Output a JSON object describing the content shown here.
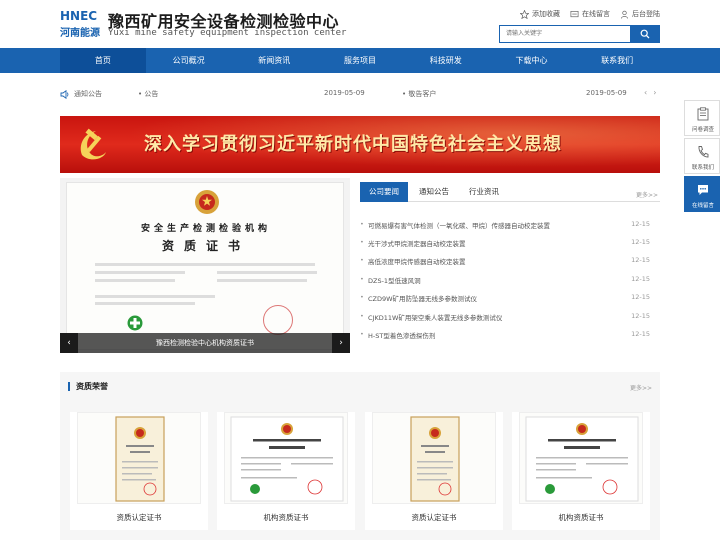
{
  "header": {
    "logo_line1": "HNEC",
    "logo_line2": "河南能源",
    "title": "豫西矿用安全设备检测检验中心",
    "subtitle": "Yuxi mine safety equipment inspection center",
    "links": [
      "添加收藏",
      "在线留言",
      "后台登陆"
    ],
    "search_placeholder": "请输入关键字"
  },
  "nav": {
    "items": [
      "首页",
      "公司概况",
      "新闻资讯",
      "服务项目",
      "科技研发",
      "下载中心",
      "联系我们"
    ],
    "active_index": 0
  },
  "notice": {
    "label": "通知公告",
    "items": [
      {
        "title": "公告",
        "date": "2019-05-09"
      },
      {
        "title": "敬告客户",
        "date": "2019-05-09"
      }
    ]
  },
  "banner": {
    "text": "深入学习贯彻习近平新时代中国特色社会主义思想"
  },
  "slider": {
    "caption": "豫西检测检验中心机构资质证书",
    "cert_heading": "安全生产检测检验机构",
    "cert_title": "资质证书"
  },
  "news": {
    "tabs": [
      "公司要闻",
      "通知公告",
      "行业资讯"
    ],
    "active_tab": 0,
    "more": "更多>>",
    "items": [
      {
        "title": "可燃易爆有害气体检测（一氧化碳、甲烷）传感器自动校定装置",
        "date": "12-15"
      },
      {
        "title": "光干涉式甲烷测定器自动校定装置",
        "date": "12-15"
      },
      {
        "title": "高低浓度甲烷传感器自动校定装置",
        "date": "12-15"
      },
      {
        "title": "DZS-1型低速风洞",
        "date": "12-15"
      },
      {
        "title": "CZD9W矿用防坠器无线多参数测试仪",
        "date": "12-15"
      },
      {
        "title": "CJKD11W矿用架空乘人装置无线多参数测试仪",
        "date": "12-15"
      },
      {
        "title": "H-ST型着色渗透探伤剂",
        "date": "12-15"
      }
    ]
  },
  "honor": {
    "title": "资质荣誉",
    "more": "更多>>",
    "cards": [
      "资质认定证书",
      "机构资质证书",
      "资质认定证书",
      "机构资质证书"
    ]
  },
  "sidebar": {
    "items": [
      "问卷调查",
      "联系我们",
      "在线留言"
    ]
  },
  "colors": {
    "primary": "#1a63b0",
    "banner_red": "#d01f15"
  }
}
